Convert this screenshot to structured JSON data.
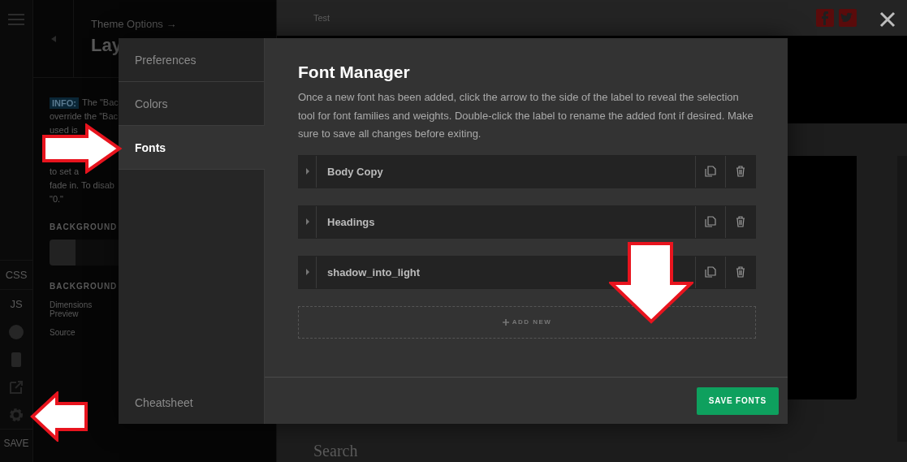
{
  "background": {
    "sidebar": {
      "items": [
        "CSS",
        "JS"
      ],
      "save": "SAVE"
    },
    "panel": {
      "breadcrumb": "Theme Options →",
      "title": "Lay",
      "info_badge": "INFO:",
      "info_lines": [
        "The \"Bac",
        "override the \"Bac",
        "used is"
      ],
      "info_lines_lower": [
        "to set a",
        "fade in. To disab",
        "\"0.\""
      ],
      "section_1": "BACKGROUND",
      "section_2": "BACKGROUND",
      "toggle_on": false,
      "field_labels": [
        "Dimensions Preview",
        "Source"
      ]
    },
    "preview": {
      "site_title": "Test",
      "widget_title": "Search"
    }
  },
  "modal": {
    "nav": [
      {
        "label": "Preferences",
        "selected": false
      },
      {
        "label": "Colors",
        "selected": false
      },
      {
        "label": "Fonts",
        "selected": true
      }
    ],
    "nav_footer": "Cheatsheet",
    "title": "Font Manager",
    "description": "Once a new font has been added, click the arrow to the side of the label to reveal the selection tool for font families and weights. Double-click the label to rename the added font if desired. Make sure to save all changes before exiting.",
    "fonts": [
      {
        "name": "Body Copy",
        "expanded": false
      },
      {
        "name": "Headings",
        "expanded": false
      },
      {
        "name": "shadow_into_light",
        "expanded": false
      }
    ],
    "add_new": "ADD NEW",
    "save_button": "SAVE FONTS"
  }
}
